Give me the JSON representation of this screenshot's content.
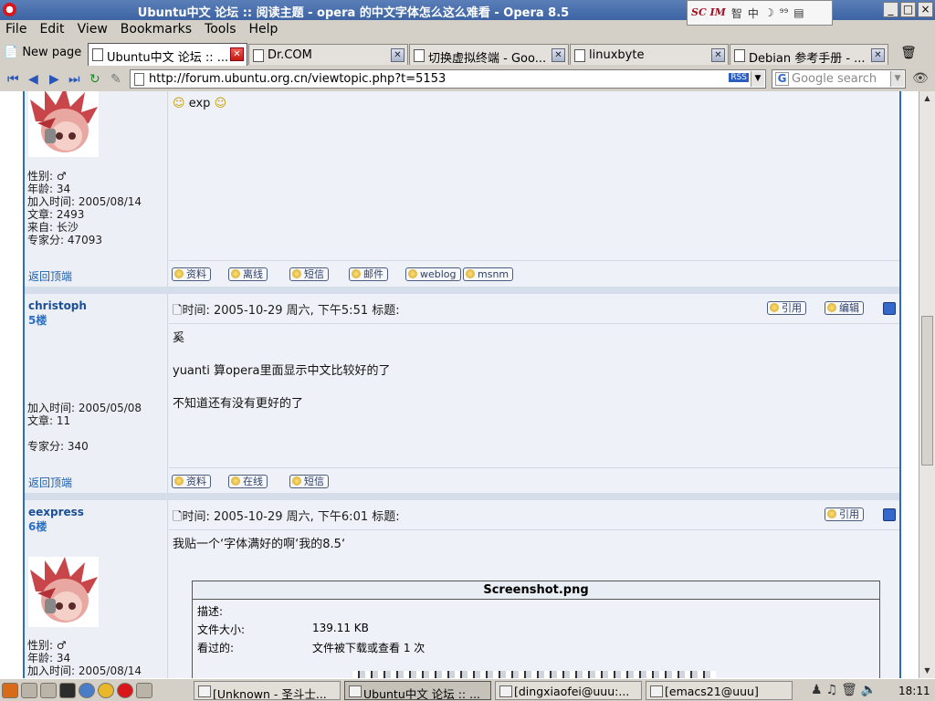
{
  "window": {
    "title": "Ubuntu中文 论坛 :: 阅读主题 - opera 的中文字体怎么这么难看 - Opera 8.5",
    "ime_icons": [
      "SC IM",
      "智",
      "中",
      "☽",
      "⁹⁹",
      "▤"
    ],
    "buttons": [
      "_",
      "□",
      "×"
    ]
  },
  "menu": [
    "File",
    "Edit",
    "View",
    "Bookmarks",
    "Tools",
    "Help"
  ],
  "tabs": {
    "new_page": "New page",
    "items": [
      {
        "label": "Ubuntu中文 论坛 :: ...",
        "active": true
      },
      {
        "label": "Dr.COM",
        "active": false
      },
      {
        "label": "切换虚拟终端 - Goo...",
        "active": false
      },
      {
        "label": "linuxbyte",
        "active": false
      },
      {
        "label": "Debian 参考手册 - ...",
        "active": false
      }
    ]
  },
  "address": {
    "url": "http://forum.ubuntu.org.cn/viewtopic.php?t=5153",
    "rss": "RSS",
    "search_placeholder": "Google search"
  },
  "posts": [
    {
      "user_lines": [
        "性别: ♂",
        "年龄: 34",
        "加入时间: 2005/08/14",
        "文章: 2493",
        "来自: 长沙",
        "专家分: 47093"
      ],
      "content_text": "exp",
      "back_to_top": "返回顶端",
      "actions": [
        "资料",
        "离线",
        "短信",
        "邮件",
        "weblog",
        "msnm"
      ]
    },
    {
      "username": "christoph",
      "floor": "5楼",
      "user_lines": [
        "加入时间: 2005/05/08",
        "文章: 11",
        "",
        "专家分: 340"
      ],
      "time": "时间: 2005-10-29 周六, 下午5:51    标题:",
      "quote": "引用",
      "edit": "编辑",
      "lines": [
        "奚",
        "yuanti 算opera里面显示中文比较好的了",
        "不知道还有没有更好的了"
      ],
      "back_to_top": "返回顶端",
      "actions": [
        "资料",
        "在线",
        "短信"
      ]
    },
    {
      "username": "eexpress",
      "floor": "6楼",
      "user_lines": [
        "性别: ♂",
        "年龄: 34",
        "加入时间: 2005/08/14"
      ],
      "time": "时间: 2005-10-29 周六, 下午6:01    标题:",
      "quote": "引用",
      "lines": [
        "我贴一个‘字体满好的啊‘我的8.5‘"
      ],
      "attachment": {
        "name": "Screenshot.png",
        "desc_label": "描述:",
        "size_label": "文件大小:",
        "size_value": "139.11 KB",
        "views_label": "看过的:",
        "views_value": "文件被下载或查看 1 次"
      }
    }
  ],
  "taskbar": {
    "tasks": [
      {
        "label": "[Unknown - 圣斗士...",
        "active": false
      },
      {
        "label": "Ubuntu中文 论坛 :: ...",
        "active": true
      },
      {
        "label": "[dingxiaofei@uuu:...",
        "active": false
      },
      {
        "label": "[emacs21@uuu]",
        "active": false
      }
    ],
    "clock": "18:11"
  },
  "colors": {
    "forum_border": "#2e6db5",
    "username": "#1b4f96",
    "link": "#1b5fb0",
    "title_bar": "#4a6fae"
  }
}
